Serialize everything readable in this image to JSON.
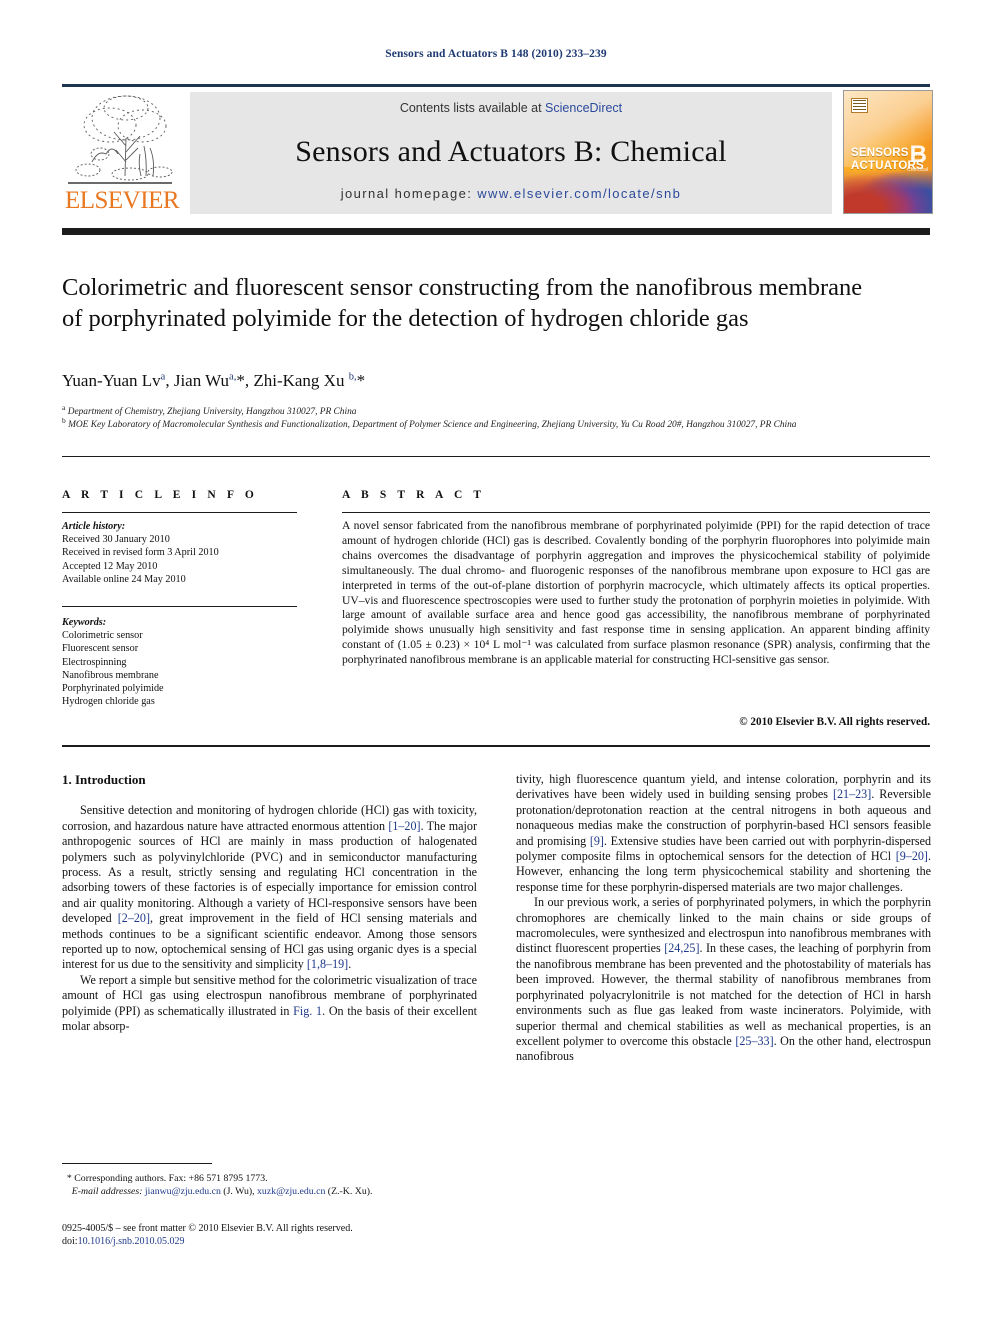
{
  "running_head": "Sensors and Actuators B 148 (2010) 233–239",
  "header": {
    "contents_prefix": "Contents lists available at ",
    "contents_link": "ScienceDirect",
    "journal_title": "Sensors and Actuators B: Chemical",
    "homepage_label": "journal homepage: ",
    "homepage_url": "www.elsevier.com/locate/snb",
    "publisher_logo_text": "ELSEVIER",
    "cover": {
      "line1": "SENSORS",
      "line1_sub": "and",
      "line2": "ACTUATORS",
      "letter": "B",
      "letter_sub": "Chemical"
    },
    "colors": {
      "link": "#2b4a9b",
      "elsevier_orange": "#E87722",
      "band_grey": "#e6e6e6",
      "rule_dark": "#1c1c1c"
    }
  },
  "article": {
    "title": "Colorimetric and fluorescent sensor constructing from the nanofibrous membrane of porphyrinated polyimide for the detection of hydrogen chloride gas",
    "authors_html": "Yuan-Yuan Lv<sup>a</sup>, Jian Wu<sup>a,</sup>*, Zhi-Kang Xu <sup>b,</sup>*",
    "affiliations": [
      {
        "marker": "a",
        "text": "Department of Chemistry, Zhejiang University, Hangzhou 310027, PR China"
      },
      {
        "marker": "b",
        "text": "MOE Key Laboratory of Macromolecular Synthesis and Functionalization, Department of Polymer Science and Engineering, Zhejiang University, Yu Cu Road 20#, Hangzhou 310027, PR China"
      }
    ]
  },
  "info": {
    "heading": "A R T I C L E   I N F O",
    "history_label": "Article history:",
    "history": [
      "Received 30 January 2010",
      "Received in revised form 3 April 2010",
      "Accepted 12 May 2010",
      "Available online 24 May 2010"
    ],
    "keywords_label": "Keywords:",
    "keywords": [
      "Colorimetric sensor",
      "Fluorescent sensor",
      "Electrospinning",
      "Nanofibrous membrane",
      "Porphyrinated polyimide",
      "Hydrogen chloride gas"
    ]
  },
  "abstract": {
    "heading": "A B S T R A C T",
    "text": "A novel sensor fabricated from the nanofibrous membrane of porphyrinated polyimide (PPI) for the rapid detection of trace amount of hydrogen chloride (HCl) gas is described. Covalently bonding of the porphyrin fluorophores into polyimide main chains overcomes the disadvantage of porphyrin aggregation and improves the physicochemical stability of polyimide simultaneously. The dual chromo- and fluorogenic responses of the nanofibrous membrane upon exposure to HCl gas are interpreted in terms of the out-of-plane distortion of porphyrin macrocycle, which ultimately affects its optical properties. UV–vis and fluorescence spectroscopies were used to further study the protonation of porphyrin moieties in polyimide. With large amount of available surface area and hence good gas accessibility, the nanofibrous membrane of porphyrinated polyimide shows unusually high sensitivity and fast response time in sensing application. An apparent binding affinity constant of (1.05 ± 0.23) × 10⁴ L mol⁻¹ was calculated from surface plasmon resonance (SPR) analysis, confirming that the porphyrinated nanofibrous membrane is an applicable material for constructing HCl-sensitive gas sensor.",
    "copyright": "© 2010 Elsevier B.V. All rights reserved."
  },
  "body": {
    "section_number_title": "1.  Introduction",
    "left_paragraphs": [
      "Sensitive detection and monitoring of hydrogen chloride (HCl) gas with toxicity, corrosion, and hazardous nature have attracted enormous attention [1–20]. The major anthropogenic sources of HCl are mainly in mass production of halogenated polymers such as polyvinylchloride (PVC) and in semiconductor manufacturing process. As a result, strictly sensing and regulating HCl concentration in the adsorbing towers of these factories is of especially importance for emission control and air quality monitoring. Although a variety of HCl-responsive sensors have been developed [2–20], great improvement in the field of HCl sensing materials and methods continues to be a significant scientific endeavor. Among those sensors reported up to now, optochemical sensing of HCl gas using organic dyes is a special interest for us due to the sensitivity and simplicity [1,8–19].",
      "We report a simple but sensitive method for the colorimetric visualization of trace amount of HCl gas using electrospun nanofibrous membrane of porphyrinated polyimide (PPI) as schematically illustrated in Fig. 1. On the basis of their excellent molar absorp-"
    ],
    "right_paragraphs": [
      "tivity, high fluorescence quantum yield, and intense coloration, porphyrin and its derivatives have been widely used in building sensing probes [21–23]. Reversible protonation/deprotonation reaction at the central nitrogens in both aqueous and nonaqueous medias make the construction of porphyrin-based HCl sensors feasible and promising [9]. Extensive studies have been carried out with porphyrin-dispersed polymer composite films in optochemical sensors for the detection of HCl [9–20]. However, enhancing the long term physicochemical stability and shortening the response time for these porphyrin-dispersed materials are two major challenges.",
      "In our previous work, a series of porphyrinated polymers, in which the porphyrin chromophores are chemically linked to the main chains or side groups of macromolecules, were synthesized and electrospun into nanofibrous membranes with distinct fluorescent properties [24,25]. In these cases, the leaching of porphyrin from the nanofibrous membrane has been prevented and the photostability of materials has been improved. However, the thermal stability of nanofibrous membranes from porphyrinated polyacrylonitrile is not matched for the detection of HCl in harsh environments such as flue gas leaked from waste incinerators. Polyimide, with superior thermal and chemical stabilities as well as mechanical properties, is an excellent polymer to overcome this obstacle [25–33]. On the other hand, electrospun nanofibrous"
    ],
    "inline_refs_left": [
      "[1–20]",
      "[2–20]",
      "[1,8–19]",
      "Fig. 1"
    ],
    "inline_refs_right": [
      "[21–23]",
      "[9]",
      "[9–20]",
      "[24,25]",
      "[25–33]"
    ]
  },
  "footer": {
    "corresponding_marker": "*",
    "corresponding": "Corresponding authors. Fax: +86 571 8795 1773.",
    "email_label": "E-mail addresses:",
    "emails": [
      {
        "address": "jianwu@zju.edu.cn",
        "person": "(J. Wu)"
      },
      {
        "address": "xuzk@zju.edu.cn",
        "person": "(Z.-K. Xu)"
      }
    ],
    "issn_line": "0925-4005/$ – see front matter © 2010 Elsevier B.V. All rights reserved.",
    "doi_label": "doi:",
    "doi": "10.1016/j.snb.2010.05.029"
  }
}
